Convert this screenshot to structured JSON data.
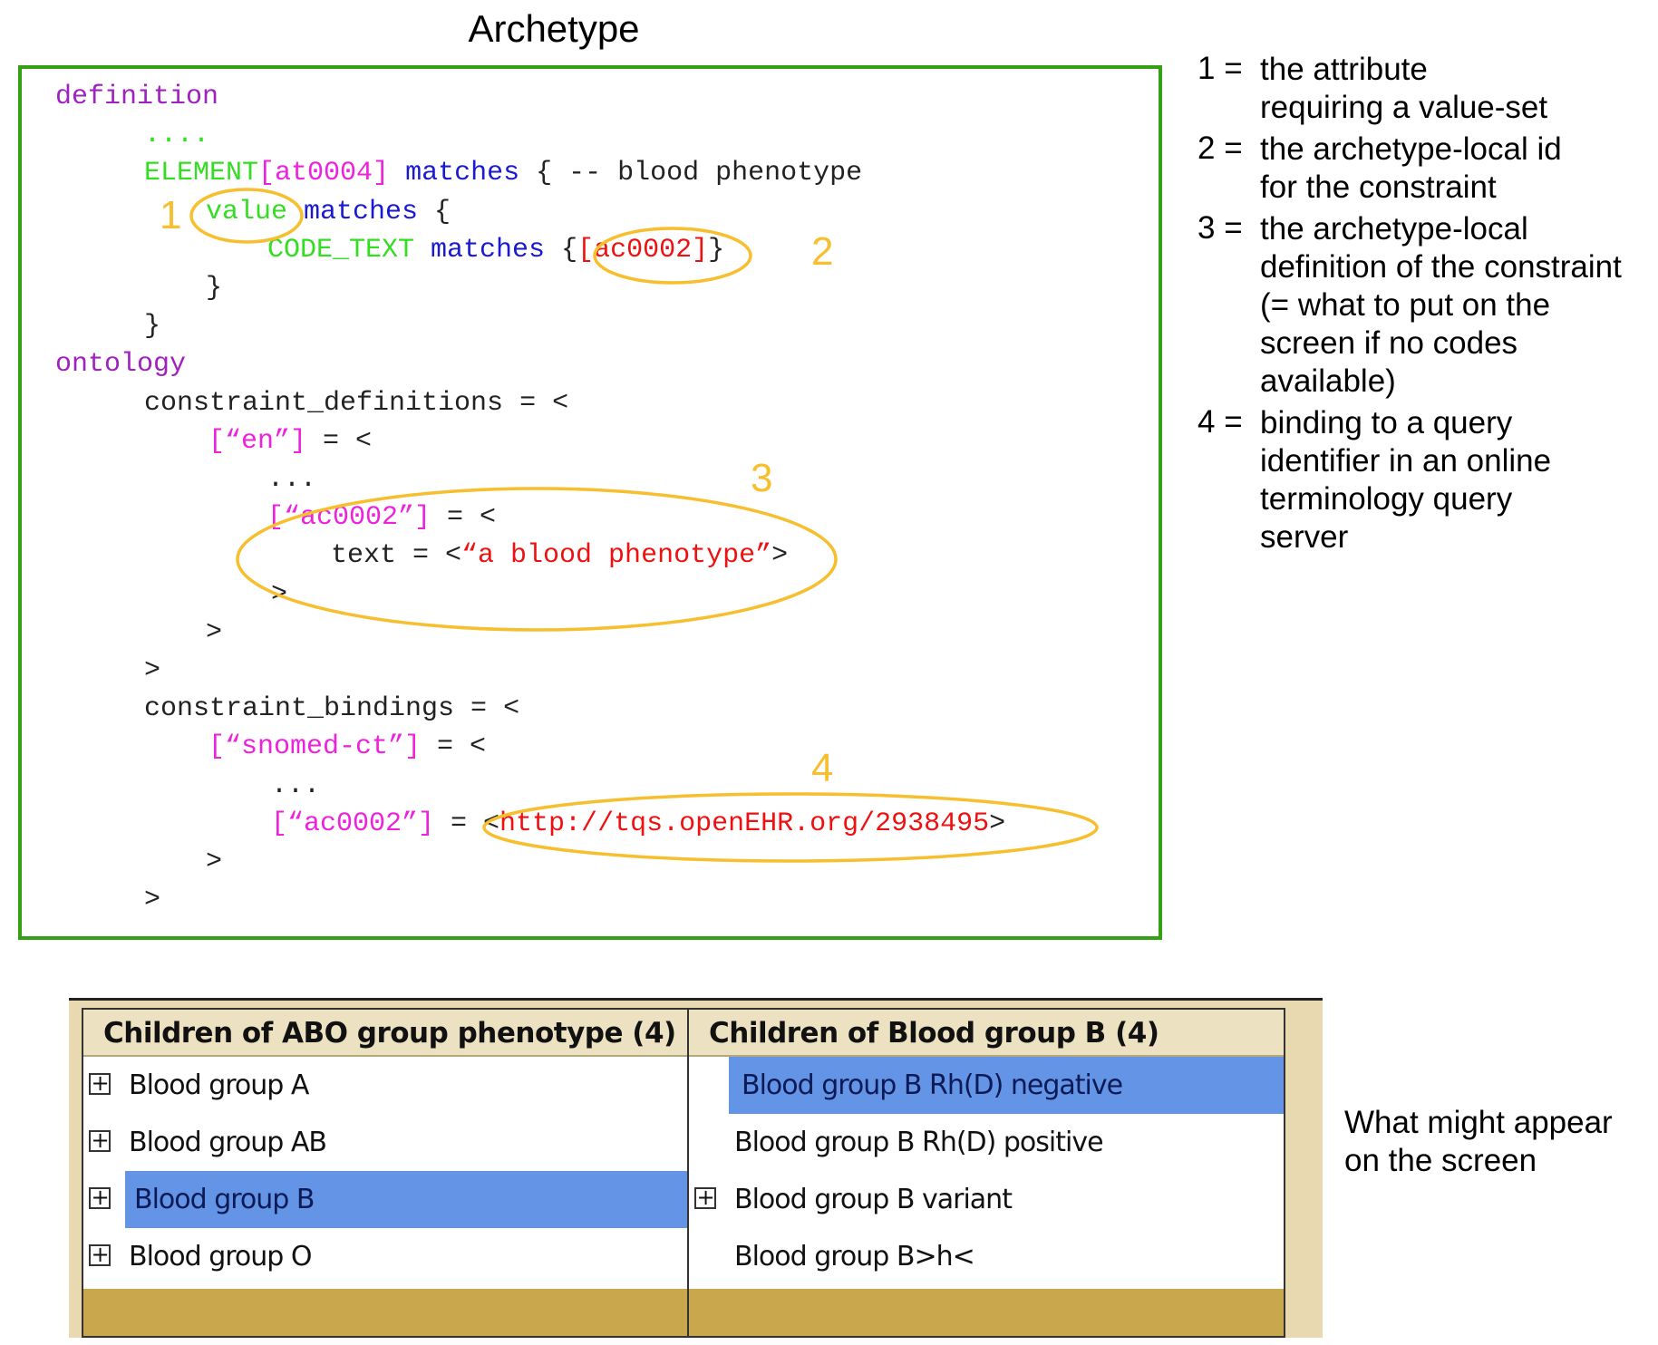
{
  "title": "Archetype",
  "code": {
    "lines": [
      {
        "indent": "def",
        "parts": [
          {
            "t": "definition",
            "c": "purple"
          }
        ]
      },
      {
        "indent": "l1",
        "parts": [
          {
            "t": "....",
            "c": "green"
          }
        ]
      },
      {
        "indent": "l1",
        "parts": [
          {
            "t": "ELEMENT",
            "c": "green"
          },
          {
            "t": "[at0004]",
            "c": "magenta"
          },
          {
            "t": " matches",
            "c": "blue"
          },
          {
            "t": " { -- blood phenotype",
            "c": "black"
          }
        ]
      },
      {
        "indent": "l2",
        "parts": [
          {
            "t": "value",
            "c": "green"
          },
          {
            "t": " matches",
            "c": "blue"
          },
          {
            "t": " {",
            "c": "black"
          }
        ]
      },
      {
        "indent": "l3",
        "parts": [
          {
            "t": "CODE_TEXT",
            "c": "green"
          },
          {
            "t": " matches",
            "c": "blue"
          },
          {
            "t": " {",
            "c": "black"
          },
          {
            "t": "[ac0002]",
            "c": "red"
          },
          {
            "t": "}",
            "c": "black"
          }
        ]
      },
      {
        "indent": "l2b",
        "parts": [
          {
            "t": "}",
            "c": "black"
          }
        ]
      },
      {
        "indent": "l1",
        "parts": [
          {
            "t": "}",
            "c": "black"
          }
        ]
      },
      {
        "indent": "def",
        "parts": [
          {
            "t": "ontology",
            "c": "purple"
          }
        ]
      },
      {
        "indent": "l1",
        "parts": [
          {
            "t": "constraint_definitions = <",
            "c": "black"
          }
        ]
      },
      {
        "indent": "l2",
        "parts": [
          {
            "t": "[“en”]",
            "c": "magenta"
          },
          {
            "t": " = <",
            "c": "black"
          }
        ]
      },
      {
        "indent": "l3",
        "parts": [
          {
            "t": "...",
            "c": "black"
          }
        ]
      },
      {
        "indent": "l3",
        "parts": [
          {
            "t": "[“ac0002”]",
            "c": "magenta"
          },
          {
            "t": " = <",
            "c": "black"
          }
        ]
      },
      {
        "indent": "l4",
        "parts": [
          {
            "t": "text = <",
            "c": "black"
          },
          {
            "t": "“a blood phenotype”",
            "c": "red"
          },
          {
            "t": ">",
            "c": "black"
          }
        ]
      },
      {
        "indent": "l3",
        "parts": [
          {
            "t": ">",
            "c": "black"
          }
        ]
      },
      {
        "indent": "l2",
        "parts": [
          {
            "t": ">",
            "c": "black"
          }
        ]
      },
      {
        "indent": "l1",
        "parts": [
          {
            "t": ">",
            "c": "black"
          }
        ]
      },
      {
        "indent": "l1",
        "parts": [
          {
            "t": "constraint_bindings = <",
            "c": "black"
          }
        ]
      },
      {
        "indent": "l2",
        "parts": [
          {
            "t": "[“snomed-ct”]",
            "c": "magenta"
          },
          {
            "t": " = <",
            "c": "black"
          }
        ]
      },
      {
        "indent": "l3",
        "parts": [
          {
            "t": "...",
            "c": "black"
          }
        ]
      },
      {
        "indent": "l3",
        "parts": [
          {
            "t": "[“ac0002”]",
            "c": "magenta"
          },
          {
            "t": " = <",
            "c": "black"
          },
          {
            "t": "http://tqs.openEHR.org/2938495",
            "c": "red"
          },
          {
            "t": ">",
            "c": "black"
          }
        ]
      },
      {
        "indent": "l2",
        "parts": [
          {
            "t": ">",
            "c": "black"
          }
        ]
      },
      {
        "indent": "l1",
        "parts": [
          {
            "t": ">",
            "c": "black"
          }
        ]
      }
    ]
  },
  "annotations": [
    {
      "num": "1"
    },
    {
      "num": "2"
    },
    {
      "num": "3"
    },
    {
      "num": "4"
    }
  ],
  "annotation_color": "#f7be2e",
  "legend": [
    {
      "num": "1 =",
      "lines": [
        "the attribute",
        "requiring a value-set"
      ]
    },
    {
      "num": "2 =",
      "lines": [
        "the archetype-local id",
        "for the constraint"
      ]
    },
    {
      "num": "3 =",
      "lines": [
        "the archetype-local",
        "definition of the constraint",
        "(= what to put on the",
        "screen if no codes",
        "available)"
      ]
    },
    {
      "num": "4 =",
      "lines": [
        "binding to a query",
        "identifier in an online",
        "terminology query",
        "server"
      ]
    }
  ],
  "screen": {
    "left_pane": {
      "header": "Children of ABO group phenotype (4)",
      "rows": [
        {
          "label": "Blood group A",
          "expandable": true,
          "selected": false
        },
        {
          "label": "Blood group AB",
          "expandable": true,
          "selected": false
        },
        {
          "label": "Blood group B",
          "expandable": true,
          "selected": true
        },
        {
          "label": "Blood group O",
          "expandable": true,
          "selected": false
        }
      ]
    },
    "right_pane": {
      "header": "Children of Blood group B (4)",
      "rows": [
        {
          "label": "Blood group B Rh(D) negative",
          "expandable": false,
          "selected": true
        },
        {
          "label": "Blood group B Rh(D) positive",
          "expandable": false,
          "selected": false
        },
        {
          "label": "Blood group B variant",
          "expandable": true,
          "selected": false
        },
        {
          "label": "Blood group B>h<",
          "expandable": false,
          "selected": false
        }
      ]
    },
    "expander_glyph": "+",
    "selection_color": "#6394e6",
    "caption": [
      "What might appear",
      "on the screen"
    ]
  }
}
